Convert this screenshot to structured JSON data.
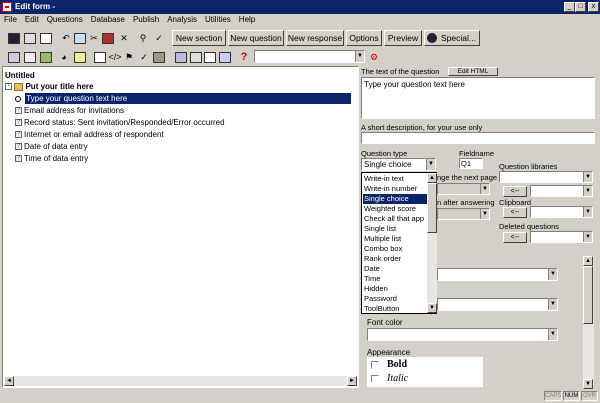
{
  "window": {
    "title": "Edit form -"
  },
  "menu": [
    "File",
    "Edit",
    "Questions",
    "Database",
    "Publish",
    "Analysis",
    "Utilities",
    "Help"
  ],
  "toolbar": {
    "buttons": [
      "New section",
      "New question",
      "New response",
      "Options",
      "Preview",
      "Special..."
    ]
  },
  "tree": {
    "root": "Untitled",
    "title": "Put your title here",
    "items": [
      "Type your question text here",
      "Email address for invitations",
      "Record status: Sent invitation/Responded/Error occurred",
      "Internet or email address of respondent",
      "Date of data entry",
      "Time of data entry"
    ]
  },
  "editor": {
    "question_text_label": "The text of the question",
    "edit_html_label": "Edit HTML",
    "question_text_value": "Type your question text here",
    "short_desc_label": "A short description, for your use only",
    "question_type_label": "Question type",
    "question_type_value": "Single choice",
    "fieldname_label": "Fieldname",
    "fieldname_value": "Q1",
    "next_page_label": "nge the next page",
    "after_answering_label": "n after answering",
    "question_libraries_label": "Question libraries",
    "clipboard_label": "Clipboard",
    "deleted_questions_label": "Deleted questions",
    "arrow_button": "<--",
    "font_color_label": "Font color",
    "appearance_label": "Appearance",
    "bold_label": "Bold",
    "italic_label": "Italic"
  },
  "question_types": [
    "Write-in text",
    "Write-in number",
    "Single choice",
    "Weighted score",
    "Check all that app",
    "Single list",
    "Multiple list",
    "Combo box",
    "Rank order",
    "Date",
    "Time",
    "Hidden",
    "Password",
    "ToolButton"
  ],
  "status": [
    "CAPS",
    "NUM",
    "OVR"
  ],
  "colors": {
    "titlebar": "#0a246a",
    "selection": "#0a246a",
    "face": "#d4d0c8"
  }
}
